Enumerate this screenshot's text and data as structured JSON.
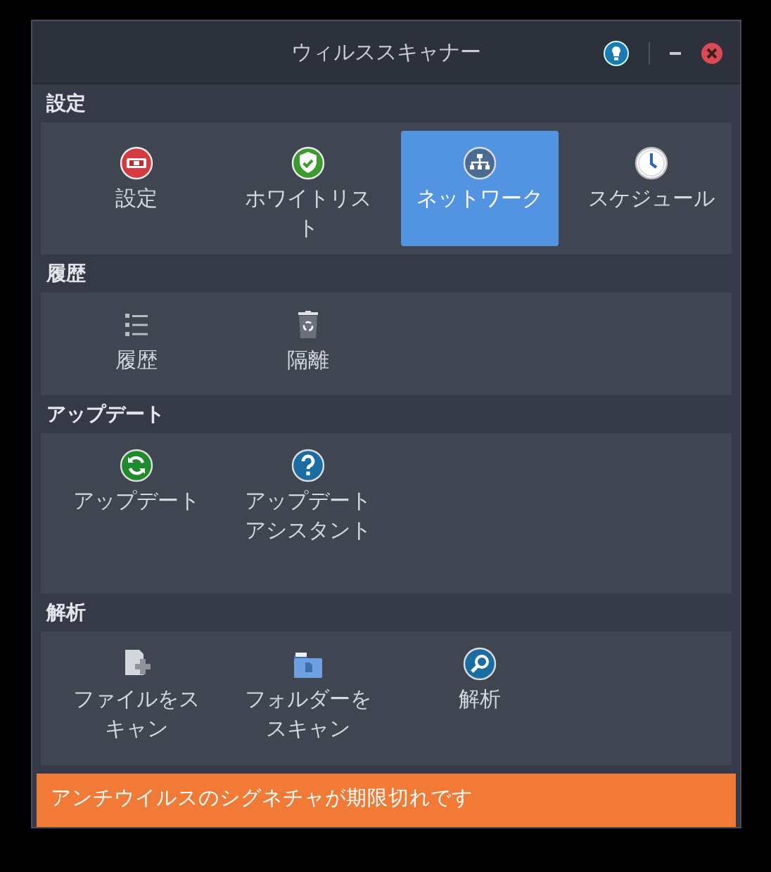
{
  "window": {
    "title": "ウィルススキャナー"
  },
  "sections": [
    {
      "title": "設定",
      "items": [
        {
          "label": "設定",
          "kind": "settings",
          "selected": false
        },
        {
          "label": "ホワイトリスト",
          "kind": "whitelist",
          "selected": false
        },
        {
          "label": "ネットワーク",
          "kind": "network",
          "selected": true
        },
        {
          "label": "スケジュール",
          "kind": "schedule",
          "selected": false
        }
      ]
    },
    {
      "title": "履歴",
      "items": [
        {
          "label": "履歴",
          "kind": "history",
          "selected": false
        },
        {
          "label": "隔離",
          "kind": "quarantine",
          "selected": false
        }
      ]
    },
    {
      "title": "アップデート",
      "items": [
        {
          "label": "アップデート",
          "kind": "update",
          "selected": false
        },
        {
          "label": "アップデートアシスタント",
          "kind": "help",
          "selected": false
        }
      ]
    },
    {
      "title": "解析",
      "items": [
        {
          "label": "ファイルをスキャン",
          "kind": "file",
          "selected": false
        },
        {
          "label": "フォルダーをスキャン",
          "kind": "folder",
          "selected": false
        },
        {
          "label": "解析",
          "kind": "analyze",
          "selected": false
        }
      ]
    }
  ],
  "status_bar": {
    "text": "アンチウイルスのシグネチャが期限切れです"
  }
}
